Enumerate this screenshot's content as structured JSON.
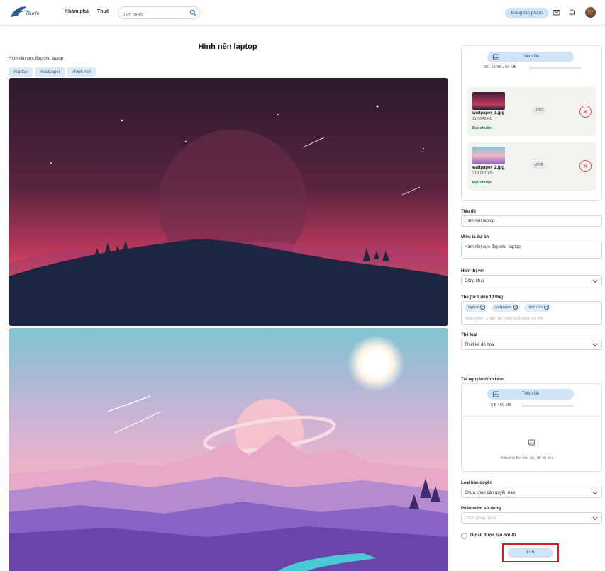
{
  "header": {
    "logo_text": "Tsurfo",
    "nav": [
      "Khám phá",
      "Thuê"
    ],
    "search_placeholder": "Tìm kiếm",
    "post_button": "Đăng tác phẩm"
  },
  "project": {
    "title": "Hình nền laptop",
    "description": "Hình nền cực đẹp cho laptop",
    "tags": [
      "#laptop",
      "#wallpaper",
      "#hình nền"
    ]
  },
  "upload": {
    "add_button": "Thêm file",
    "quota": "431.55 KB / 50 MB",
    "files": [
      {
        "name": "wallpaper_1.jpg",
        "size": "117,648 KB",
        "ext": ".JPG",
        "status": "Đạt chuẩn"
      },
      {
        "name": "wallpaper_2.jpg",
        "size": "313,901 KB",
        "ext": ".JPG",
        "status": "Đạt chuẩn"
      }
    ]
  },
  "form": {
    "title_label": "Tiêu đề",
    "title_value": "Hình nền laptop",
    "desc_label": "Miêu tả dự án",
    "desc_value": "Hình nền cực đẹp cho  laptop",
    "visibility_label": "Hiển thị với",
    "visibility_value": "Công khai",
    "tags_label": "Thẻ (từ 1 đến 10 thẻ)",
    "tags": [
      "laptop",
      "wallpaper",
      "hình nền"
    ],
    "tags_hint": "Nhấn phím \"Enter\" để phân tách giữa các thẻ",
    "category_label": "Thể loại",
    "category_value": "Thiết kế đồ họa",
    "attach_label": "Tài nguyên đính kèm",
    "attach_button": "Thêm file",
    "attach_quota": "0 B / 50 MB",
    "drop_text": "Kéo thả file vào đây để tải lên.",
    "license_label": "Loại bản quyền",
    "license_value": "Chưa chọn bản quyền nào",
    "software_label": "Phần mềm sử dụng",
    "software_placeholder": "Chọn phần mềm",
    "ai_label": "Dự án được tạo bởi AI",
    "save_button": "Lưu"
  },
  "colors": {
    "accent": "#cfe3f4",
    "accent_text": "#2f5f8a",
    "ok": "#1f8a3a",
    "danger": "#d71d1d"
  }
}
